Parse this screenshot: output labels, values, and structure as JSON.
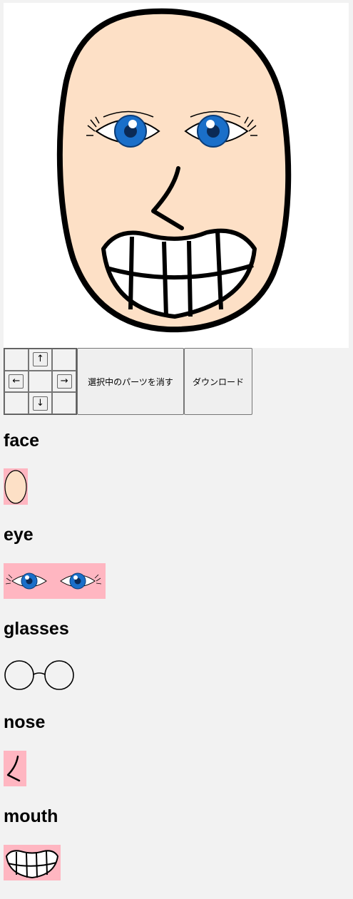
{
  "controls": {
    "up": "↑",
    "down": "↓",
    "left": "←",
    "right": "→",
    "delete_label": "選択中のパーツを消す",
    "download_label": "ダウンロード"
  },
  "categories": [
    "face",
    "eye",
    "glasses",
    "nose",
    "mouth"
  ],
  "colors": {
    "page_bg": "#f2f2f2",
    "canvas_bg": "#ffffff",
    "skin": "#fde0c6",
    "iris": "#1a6fc9",
    "selected_highlight": "#ffb6c1"
  }
}
